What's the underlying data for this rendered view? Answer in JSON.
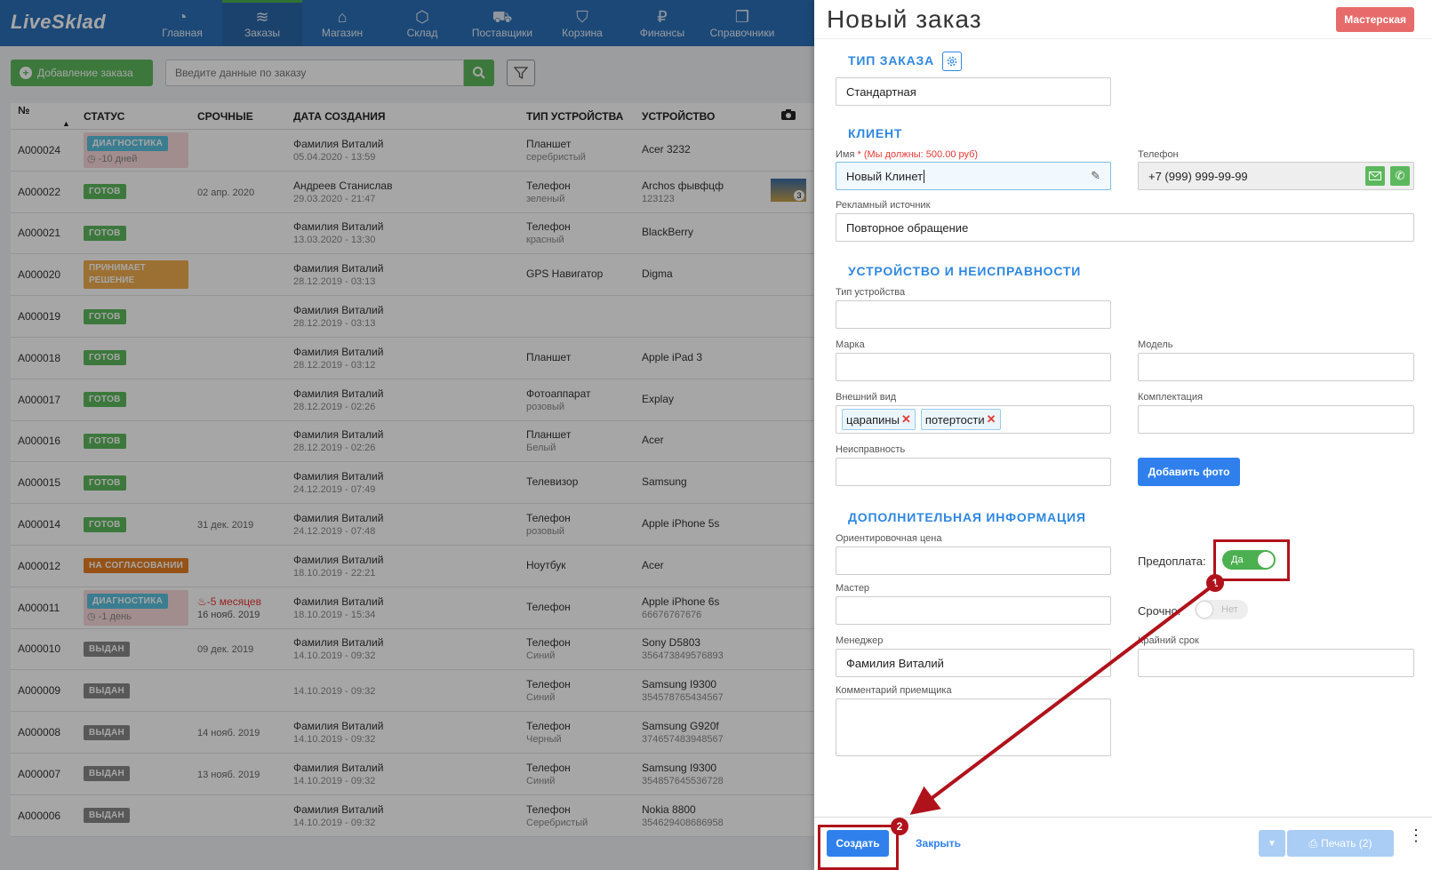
{
  "app": {
    "logo": "LiveSklad",
    "nav": [
      {
        "label": "Главная",
        "icon": "dashboard-icon",
        "glyph": "◔"
      },
      {
        "label": "Заказы",
        "icon": "orders-icon",
        "glyph": "≋"
      },
      {
        "label": "Магазин",
        "icon": "store-icon",
        "glyph": "⌂"
      },
      {
        "label": "Склад",
        "icon": "box-icon",
        "glyph": "⬡"
      },
      {
        "label": "Поставщики",
        "icon": "truck-icon",
        "glyph": "⛟"
      },
      {
        "label": "Корзина",
        "icon": "cart-icon",
        "glyph": "⛉"
      },
      {
        "label": "Финансы",
        "icon": "ruble-icon",
        "glyph": "₽"
      },
      {
        "label": "Справочники",
        "icon": "catalog-icon",
        "glyph": "❐"
      }
    ],
    "add_order_label": "Добавление заказа",
    "search_placeholder": "Введите данные по заказу",
    "columns": {
      "num": "№",
      "status": "СТАТУС",
      "urgent": "СРОЧНЫЕ",
      "date": "ДАТА СОЗДАНИЯ",
      "type": "ТИП УСТРОЙСТВА",
      "device": "УСТРОЙСТВО"
    },
    "orders": [
      {
        "num": "A000024",
        "status": "ДИАГНОСТИКА",
        "status_color": "#5bc0de",
        "status_sub": "-10 дней",
        "urgent": "",
        "client": "Фамилия Виталий",
        "date": "05.04.2020 - 13:59",
        "type": "Планшет",
        "type_sub": "серебристый",
        "device": "Acer 3232",
        "device_sub": ""
      },
      {
        "num": "A000022",
        "status": "ГОТОВ",
        "status_color": "#5cb85c",
        "status_sub": "",
        "urgent": "02 апр. 2020",
        "client": "Андреев Станислав",
        "date": "29.03.2020 - 21:47",
        "type": "Телефон",
        "type_sub": "зеленый",
        "device": "Archos фывфцф",
        "device_sub": "123123",
        "photo": "3"
      },
      {
        "num": "A000021",
        "status": "ГОТОВ",
        "status_color": "#5cb85c",
        "status_sub": "",
        "urgent": "",
        "client": "Фамилия Виталий",
        "date": "13.03.2020 - 13:30",
        "type": "Телефон",
        "type_sub": "красный",
        "device": "BlackBerry",
        "device_sub": ""
      },
      {
        "num": "A000020",
        "status": "ПРИНИМАЕТ РЕШЕНИЕ",
        "status_color": "#f0ad4e",
        "status_sub": "",
        "urgent": "",
        "client": "Фамилия Виталий",
        "date": "28.12.2019 - 03:13",
        "type": "GPS Навигатор",
        "type_sub": "",
        "device": "Digma",
        "device_sub": ""
      },
      {
        "num": "A000019",
        "status": "ГОТОВ",
        "status_color": "#5cb85c",
        "status_sub": "",
        "urgent": "",
        "client": "Фамилия Виталий",
        "date": "28.12.2019 - 03:13",
        "type": "",
        "type_sub": "",
        "device": "",
        "device_sub": ""
      },
      {
        "num": "A000018",
        "status": "ГОТОВ",
        "status_color": "#5cb85c",
        "status_sub": "",
        "urgent": "",
        "client": "Фамилия Виталий",
        "date": "28.12.2019 - 03:12",
        "type": "Планшет",
        "type_sub": "",
        "device": "Apple iPad 3",
        "device_sub": ""
      },
      {
        "num": "A000017",
        "status": "ГОТОВ",
        "status_color": "#5cb85c",
        "status_sub": "",
        "urgent": "",
        "client": "Фамилия Виталий",
        "date": "28.12.2019 - 02:26",
        "type": "Фотоаппарат",
        "type_sub": "розовый",
        "device": "Explay",
        "device_sub": ""
      },
      {
        "num": "A000016",
        "status": "ГОТОВ",
        "status_color": "#5cb85c",
        "status_sub": "",
        "urgent": "",
        "client": "Фамилия Виталий",
        "date": "28.12.2019 - 02:26",
        "type": "Планшет",
        "type_sub": "Белый",
        "device": "Acer",
        "device_sub": ""
      },
      {
        "num": "A000015",
        "status": "ГОТОВ",
        "status_color": "#5cb85c",
        "status_sub": "",
        "urgent": "",
        "client": "Фамилия Виталий",
        "date": "24.12.2019 - 07:49",
        "type": "Телевизор",
        "type_sub": "",
        "device": "Samsung",
        "device_sub": ""
      },
      {
        "num": "A000014",
        "status": "ГОТОВ",
        "status_color": "#5cb85c",
        "status_sub": "",
        "urgent": "31 дек. 2019",
        "client": "Фамилия Виталий",
        "date": "24.12.2019 - 07:48",
        "type": "Телефон",
        "type_sub": "розовый",
        "device": "Apple iPhone 5s",
        "device_sub": ""
      },
      {
        "num": "A000012",
        "status": "НА СОГЛАСОВАНИИ",
        "status_color": "#e67e22",
        "status_sub": "",
        "urgent": "",
        "client": "Фамилия Виталий",
        "date": "18.10.2019 - 22:21",
        "type": "Ноутбук",
        "type_sub": "",
        "device": "Acer",
        "device_sub": ""
      },
      {
        "num": "A000011",
        "status": "ДИАГНОСТИКА",
        "status_color": "#5bc0de",
        "status_sub": "-1 день",
        "urgent": "-5 месяцев",
        "urgent_sub": "16 нояб. 2019",
        "client": "Фамилия Виталий",
        "date": "18.10.2019 - 15:34",
        "type": "Телефон",
        "type_sub": "",
        "device": "Apple iPhone 6s",
        "device_sub": "66676767676"
      },
      {
        "num": "A000010",
        "status": "ВЫДАН",
        "status_color": "#888888",
        "status_sub": "",
        "urgent": "09 дек. 2019",
        "client": "Фамилия Виталий",
        "date": "14.10.2019 - 09:32",
        "type": "Телефон",
        "type_sub": "Синий",
        "device": "Sony D5803",
        "device_sub": "356473849576893"
      },
      {
        "num": "A000009",
        "status": "ВЫДАН",
        "status_color": "#888888",
        "status_sub": "",
        "urgent": "",
        "client": "",
        "date": "14.10.2019 - 09:32",
        "type": "Телефон",
        "type_sub": "Синий",
        "device": "Samsung I9300",
        "device_sub": "354578765434567"
      },
      {
        "num": "A000008",
        "status": "ВЫДАН",
        "status_color": "#888888",
        "status_sub": "",
        "urgent": "14 нояб. 2019",
        "client": "Фамилия Виталий",
        "date": "14.10.2019 - 09:32",
        "type": "Телефон",
        "type_sub": "Черный",
        "device": "Samsung G920f",
        "device_sub": "374657483948567"
      },
      {
        "num": "A000007",
        "status": "ВЫДАН",
        "status_color": "#888888",
        "status_sub": "",
        "urgent": "13 нояб. 2019",
        "client": "Фамилия Виталий",
        "date": "14.10.2019 - 09:32",
        "type": "Телефон",
        "type_sub": "Синий",
        "device": "Samsung I9300",
        "device_sub": "354857645536728"
      },
      {
        "num": "A000006",
        "status": "ВЫДАН",
        "status_color": "#888888",
        "status_sub": "",
        "urgent": "",
        "client": "Фамилия Виталий",
        "date": "14.10.2019 - 09:32",
        "type": "Телефон",
        "type_sub": "Серебристый",
        "device": "Nokia 8800",
        "device_sub": "354629408686958"
      }
    ]
  },
  "panel": {
    "title": "Новый заказ",
    "badge": "Мастерская",
    "sections": {
      "order_type": "ТИП ЗАКАЗА",
      "client": "КЛИЕНТ",
      "device": "УСТРОЙСТВО И НЕИСПРАВНОСТИ",
      "extra": "ДОПОЛНИТЕЛЬНАЯ ИНФОРМАЦИЯ"
    },
    "order_type_value": "Стандартная",
    "name_label": "Имя",
    "name_required": "* (Мы должны: 500.00 руб)",
    "name_value": "Новый Клинет",
    "phone_label": "Телефон",
    "phone_value": "+7 (999) 999-99-99",
    "ad_label": "Рекламный источник",
    "ad_value": "Повторное обращение",
    "device_type_label": "Тип устройства",
    "brand_label": "Марка",
    "model_label": "Модель",
    "appearance_label": "Внешний вид",
    "appearance_tags": [
      "царапины",
      "потертости"
    ],
    "kit_label": "Комплектация",
    "fault_label": "Неисправность",
    "add_photo": "Добавить фото",
    "price_label": "Ориентировочная цена",
    "prepay_label": "Предоплата:",
    "prepay_value": "Да",
    "master_label": "Мастер",
    "urgent_label": "Срочно:",
    "urgent_value": "Нет",
    "manager_label": "Менеджер",
    "manager_value": "Фамилия Виталий",
    "deadline_label": "Крайний срок",
    "comment_label": "Комментарий приемщика",
    "create_btn": "Создать",
    "close_btn": "Закрыть",
    "print_btn": "Печать (2)",
    "annotations": [
      "1",
      "2"
    ]
  },
  "colors": {
    "accent": "#2f80ed",
    "annotation": "#b0121b",
    "success": "#4cb050"
  }
}
